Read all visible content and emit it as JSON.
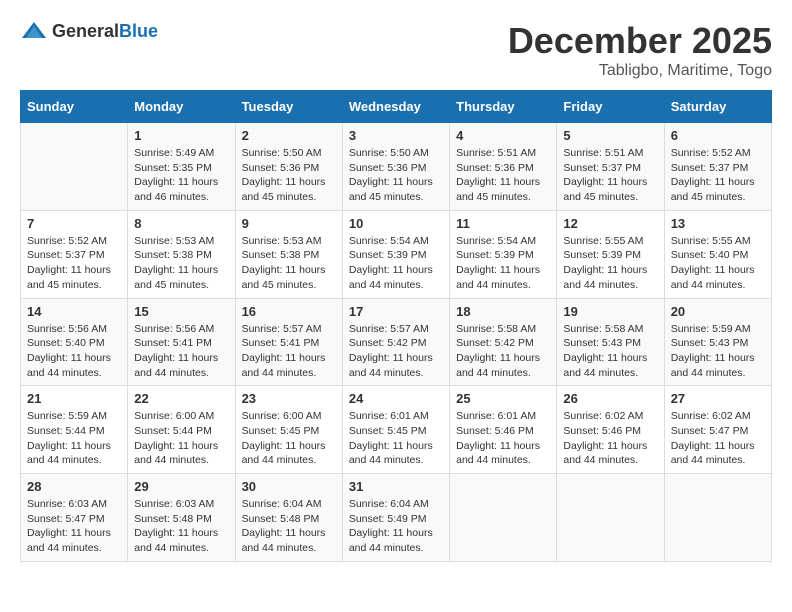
{
  "header": {
    "logo_general": "General",
    "logo_blue": "Blue",
    "month": "December 2025",
    "location": "Tabligbo, Maritime, Togo"
  },
  "days_of_week": [
    "Sunday",
    "Monday",
    "Tuesday",
    "Wednesday",
    "Thursday",
    "Friday",
    "Saturday"
  ],
  "weeks": [
    [
      {
        "day": "",
        "sunrise": "",
        "sunset": "",
        "daylight": ""
      },
      {
        "day": "1",
        "sunrise": "Sunrise: 5:49 AM",
        "sunset": "Sunset: 5:35 PM",
        "daylight": "Daylight: 11 hours and 46 minutes."
      },
      {
        "day": "2",
        "sunrise": "Sunrise: 5:50 AM",
        "sunset": "Sunset: 5:36 PM",
        "daylight": "Daylight: 11 hours and 45 minutes."
      },
      {
        "day": "3",
        "sunrise": "Sunrise: 5:50 AM",
        "sunset": "Sunset: 5:36 PM",
        "daylight": "Daylight: 11 hours and 45 minutes."
      },
      {
        "day": "4",
        "sunrise": "Sunrise: 5:51 AM",
        "sunset": "Sunset: 5:36 PM",
        "daylight": "Daylight: 11 hours and 45 minutes."
      },
      {
        "day": "5",
        "sunrise": "Sunrise: 5:51 AM",
        "sunset": "Sunset: 5:37 PM",
        "daylight": "Daylight: 11 hours and 45 minutes."
      },
      {
        "day": "6",
        "sunrise": "Sunrise: 5:52 AM",
        "sunset": "Sunset: 5:37 PM",
        "daylight": "Daylight: 11 hours and 45 minutes."
      }
    ],
    [
      {
        "day": "7",
        "sunrise": "Sunrise: 5:52 AM",
        "sunset": "Sunset: 5:37 PM",
        "daylight": "Daylight: 11 hours and 45 minutes."
      },
      {
        "day": "8",
        "sunrise": "Sunrise: 5:53 AM",
        "sunset": "Sunset: 5:38 PM",
        "daylight": "Daylight: 11 hours and 45 minutes."
      },
      {
        "day": "9",
        "sunrise": "Sunrise: 5:53 AM",
        "sunset": "Sunset: 5:38 PM",
        "daylight": "Daylight: 11 hours and 45 minutes."
      },
      {
        "day": "10",
        "sunrise": "Sunrise: 5:54 AM",
        "sunset": "Sunset: 5:39 PM",
        "daylight": "Daylight: 11 hours and 44 minutes."
      },
      {
        "day": "11",
        "sunrise": "Sunrise: 5:54 AM",
        "sunset": "Sunset: 5:39 PM",
        "daylight": "Daylight: 11 hours and 44 minutes."
      },
      {
        "day": "12",
        "sunrise": "Sunrise: 5:55 AM",
        "sunset": "Sunset: 5:39 PM",
        "daylight": "Daylight: 11 hours and 44 minutes."
      },
      {
        "day": "13",
        "sunrise": "Sunrise: 5:55 AM",
        "sunset": "Sunset: 5:40 PM",
        "daylight": "Daylight: 11 hours and 44 minutes."
      }
    ],
    [
      {
        "day": "14",
        "sunrise": "Sunrise: 5:56 AM",
        "sunset": "Sunset: 5:40 PM",
        "daylight": "Daylight: 11 hours and 44 minutes."
      },
      {
        "day": "15",
        "sunrise": "Sunrise: 5:56 AM",
        "sunset": "Sunset: 5:41 PM",
        "daylight": "Daylight: 11 hours and 44 minutes."
      },
      {
        "day": "16",
        "sunrise": "Sunrise: 5:57 AM",
        "sunset": "Sunset: 5:41 PM",
        "daylight": "Daylight: 11 hours and 44 minutes."
      },
      {
        "day": "17",
        "sunrise": "Sunrise: 5:57 AM",
        "sunset": "Sunset: 5:42 PM",
        "daylight": "Daylight: 11 hours and 44 minutes."
      },
      {
        "day": "18",
        "sunrise": "Sunrise: 5:58 AM",
        "sunset": "Sunset: 5:42 PM",
        "daylight": "Daylight: 11 hours and 44 minutes."
      },
      {
        "day": "19",
        "sunrise": "Sunrise: 5:58 AM",
        "sunset": "Sunset: 5:43 PM",
        "daylight": "Daylight: 11 hours and 44 minutes."
      },
      {
        "day": "20",
        "sunrise": "Sunrise: 5:59 AM",
        "sunset": "Sunset: 5:43 PM",
        "daylight": "Daylight: 11 hours and 44 minutes."
      }
    ],
    [
      {
        "day": "21",
        "sunrise": "Sunrise: 5:59 AM",
        "sunset": "Sunset: 5:44 PM",
        "daylight": "Daylight: 11 hours and 44 minutes."
      },
      {
        "day": "22",
        "sunrise": "Sunrise: 6:00 AM",
        "sunset": "Sunset: 5:44 PM",
        "daylight": "Daylight: 11 hours and 44 minutes."
      },
      {
        "day": "23",
        "sunrise": "Sunrise: 6:00 AM",
        "sunset": "Sunset: 5:45 PM",
        "daylight": "Daylight: 11 hours and 44 minutes."
      },
      {
        "day": "24",
        "sunrise": "Sunrise: 6:01 AM",
        "sunset": "Sunset: 5:45 PM",
        "daylight": "Daylight: 11 hours and 44 minutes."
      },
      {
        "day": "25",
        "sunrise": "Sunrise: 6:01 AM",
        "sunset": "Sunset: 5:46 PM",
        "daylight": "Daylight: 11 hours and 44 minutes."
      },
      {
        "day": "26",
        "sunrise": "Sunrise: 6:02 AM",
        "sunset": "Sunset: 5:46 PM",
        "daylight": "Daylight: 11 hours and 44 minutes."
      },
      {
        "day": "27",
        "sunrise": "Sunrise: 6:02 AM",
        "sunset": "Sunset: 5:47 PM",
        "daylight": "Daylight: 11 hours and 44 minutes."
      }
    ],
    [
      {
        "day": "28",
        "sunrise": "Sunrise: 6:03 AM",
        "sunset": "Sunset: 5:47 PM",
        "daylight": "Daylight: 11 hours and 44 minutes."
      },
      {
        "day": "29",
        "sunrise": "Sunrise: 6:03 AM",
        "sunset": "Sunset: 5:48 PM",
        "daylight": "Daylight: 11 hours and 44 minutes."
      },
      {
        "day": "30",
        "sunrise": "Sunrise: 6:04 AM",
        "sunset": "Sunset: 5:48 PM",
        "daylight": "Daylight: 11 hours and 44 minutes."
      },
      {
        "day": "31",
        "sunrise": "Sunrise: 6:04 AM",
        "sunset": "Sunset: 5:49 PM",
        "daylight": "Daylight: 11 hours and 44 minutes."
      },
      {
        "day": "",
        "sunrise": "",
        "sunset": "",
        "daylight": ""
      },
      {
        "day": "",
        "sunrise": "",
        "sunset": "",
        "daylight": ""
      },
      {
        "day": "",
        "sunrise": "",
        "sunset": "",
        "daylight": ""
      }
    ]
  ]
}
